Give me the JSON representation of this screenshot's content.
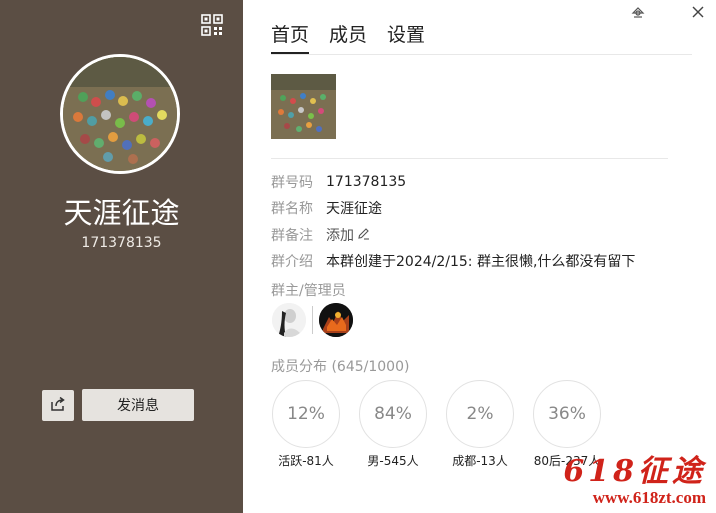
{
  "left_panel": {
    "group_name": "天涯征途",
    "group_number": "171378135",
    "send_message_label": "发消息",
    "background_color": "#5b4e44"
  },
  "icons": {
    "qr": "qr-code-icon",
    "share": "share-icon",
    "pin": "pin-icon",
    "close": "close-icon",
    "edit": "edit-pencil-icon"
  },
  "tabs": [
    {
      "label": "首页",
      "active": true
    },
    {
      "label": "成员",
      "active": false
    },
    {
      "label": "设置",
      "active": false
    }
  ],
  "info": {
    "group_number_label": "群号码",
    "group_number_value": "171378135",
    "group_name_label": "群名称",
    "group_name_value": "天涯征途",
    "remark_label": "群备注",
    "remark_add": "添加",
    "intro_label": "群介绍",
    "intro_value": "本群创建于2024/2/15:  群主很懒,什么都没有留下"
  },
  "admins_label": "群主/管理员",
  "distribution": {
    "label": "成员分布 (645/1000)",
    "stats": [
      {
        "percent": "12%",
        "label": "活跃-81人"
      },
      {
        "percent": "84%",
        "label": "男-545人"
      },
      {
        "percent": "2%",
        "label": "成都-13人"
      },
      {
        "percent": "36%",
        "label": "80后-237人"
      }
    ]
  },
  "watermark": {
    "text": "618征途",
    "url": "www.618zt.com",
    "color": "#d0231a"
  }
}
